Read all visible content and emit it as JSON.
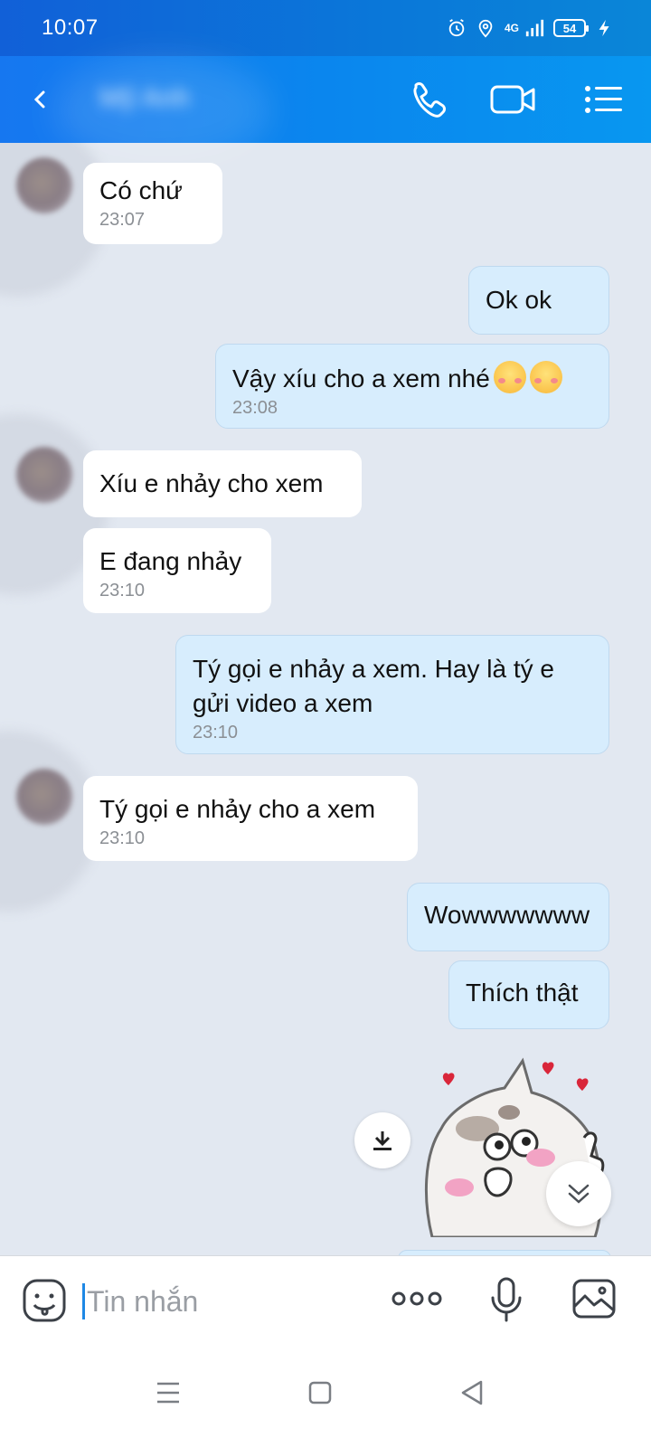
{
  "status_bar": {
    "time": "10:07",
    "network": "4G",
    "battery": "54"
  },
  "header": {
    "contact_name": "Mỹ Anh",
    "icons": [
      "back-icon",
      "phone-icon",
      "video-camera-icon",
      "list-menu-icon"
    ]
  },
  "messages": [
    {
      "side": "in",
      "text": "Có chứ",
      "time": "23:07"
    },
    {
      "side": "out",
      "text": "Ok ok",
      "time": ""
    },
    {
      "side": "out",
      "text": "Vậy xíu cho a xem nhé",
      "time": "23:08",
      "emoji": "blushing-face-emoji"
    },
    {
      "side": "in",
      "text": "Xíu e nhảy cho xem",
      "time": ""
    },
    {
      "side": "in",
      "text": "E đang nhảy",
      "time": "23:10"
    },
    {
      "side": "out",
      "text_line1": "Tý gọi e nhảy a xem. Hay là tý e",
      "text_line2": "gửi video a xem",
      "time": "23:10"
    },
    {
      "side": "in",
      "text": "Tý gọi e nhảy cho a xem",
      "time": "23:10"
    },
    {
      "side": "out",
      "text": "Wowwwwwww",
      "time": ""
    },
    {
      "side": "out",
      "text": "Thích thật",
      "time": ""
    },
    {
      "side": "out",
      "type": "sticker",
      "sticker": "cat-sticker"
    }
  ],
  "input": {
    "placeholder": "Tin nhắn"
  },
  "colors": {
    "header": "#0a86ee",
    "incoming_bubble": "#ffffff",
    "outgoing_bubble": "#d7edfd",
    "background": "#e2e8f1",
    "accent": "#1e88e5"
  }
}
